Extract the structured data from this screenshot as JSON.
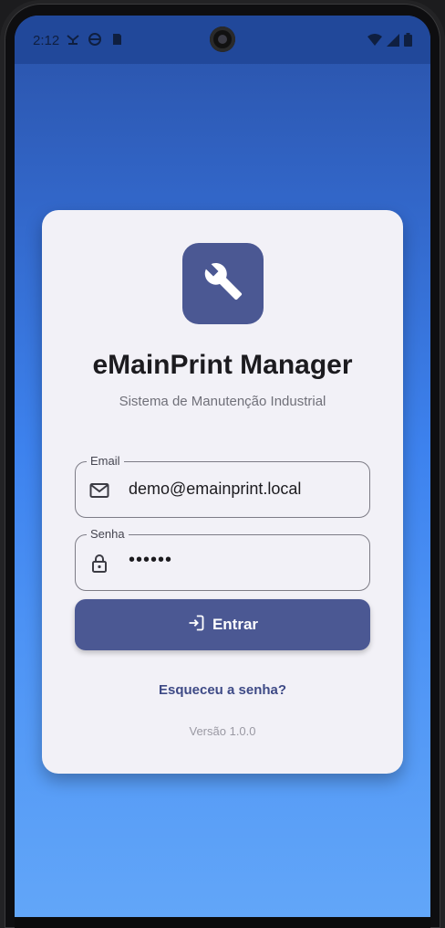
{
  "status_bar": {
    "time": "2:12",
    "left_icons": [
      "network-icon",
      "vpn-icon",
      "sd-card-icon"
    ],
    "right_icons": [
      "wifi-icon",
      "signal-icon",
      "battery-icon"
    ]
  },
  "login_card": {
    "logo_icon": "wrench-icon",
    "title": "eMainPrint Manager",
    "subtitle": "Sistema de Manutenção Industrial",
    "email_field": {
      "label": "Email",
      "value": "demo@emainprint.local",
      "icon": "mail-icon"
    },
    "password_field": {
      "label": "Senha",
      "value": "••••••",
      "icon": "lock-icon"
    },
    "submit_button": {
      "label": "Entrar",
      "icon": "login-icon"
    },
    "forgot_link": "Esqueceu a senha?",
    "version": "Versão 1.0.0"
  },
  "colors": {
    "primary": "#4b5893",
    "card_background": "#f2f1f7",
    "gradient_top": "#2a52a8",
    "gradient_bottom": "#62a6f8"
  }
}
